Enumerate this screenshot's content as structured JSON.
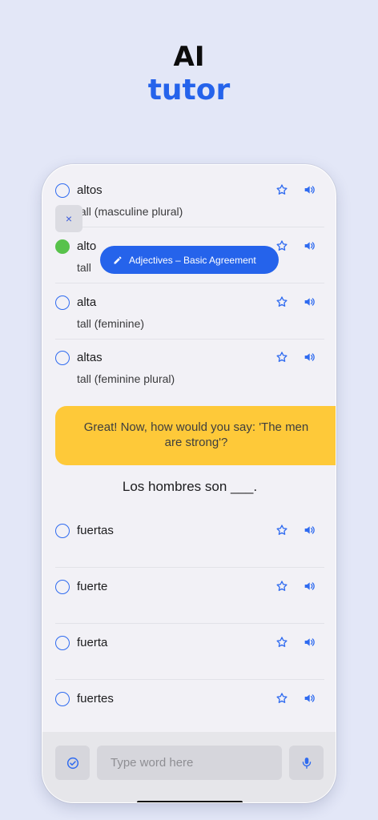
{
  "hero": {
    "line1": "AI",
    "line2": "tutor"
  },
  "colors": {
    "accent": "#2563eb",
    "bubble": "#fec939",
    "correct": "#58c24b",
    "background": "#e3e7f7"
  },
  "topic_pill": {
    "label": "Adjectives – Basic Agreement",
    "icon": "pencil-icon"
  },
  "close_button": {
    "label": "×"
  },
  "previous_options": [
    {
      "word": "altos",
      "meaning": "tall (masculine plural)",
      "selected": false
    },
    {
      "word": "alto",
      "meaning": "tall",
      "selected": true
    },
    {
      "word": "alta",
      "meaning": "tall (feminine)",
      "selected": false
    },
    {
      "word": "altas",
      "meaning": "tall (feminine plural)",
      "selected": false
    }
  ],
  "tutor_message": "Great! Now, how would you say: 'The men are strong'?",
  "question": "Los hombres son ___.",
  "current_options": [
    {
      "word": "fuertas"
    },
    {
      "word": "fuerte"
    },
    {
      "word": "fuerta"
    },
    {
      "word": "fuertes"
    }
  ],
  "input": {
    "placeholder": "Type word here",
    "value": ""
  },
  "icons": {
    "row_favorite": "star-icon",
    "row_audio": "speaker-icon",
    "submit": "check-circle-icon",
    "voice": "microphone-icon"
  }
}
